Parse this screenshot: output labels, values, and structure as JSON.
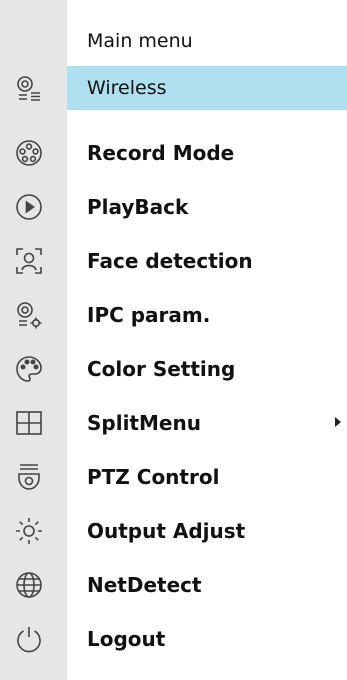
{
  "menu": {
    "header": "Main menu",
    "items": [
      {
        "label": "Wireless",
        "icon": "camera-list-icon"
      },
      {
        "label": "Record Mode",
        "icon": "film-reel-icon"
      },
      {
        "label": "PlayBack",
        "icon": "play-circle-icon"
      },
      {
        "label": "Face detection",
        "icon": "face-detection-icon"
      },
      {
        "label": "IPC param.",
        "icon": "camera-settings-icon"
      },
      {
        "label": "Color Setting",
        "icon": "palette-icon"
      },
      {
        "label": "SplitMenu",
        "icon": "split-grid-icon"
      },
      {
        "label": "PTZ Control",
        "icon": "ptz-camera-icon"
      },
      {
        "label": "Output Adjust",
        "icon": "brightness-icon"
      },
      {
        "label": "NetDetect",
        "icon": "globe-icon"
      },
      {
        "label": "Logout",
        "icon": "power-icon"
      }
    ]
  },
  "colors": {
    "highlight": "#aee0ef",
    "icon_column": "#e6e6e6"
  }
}
